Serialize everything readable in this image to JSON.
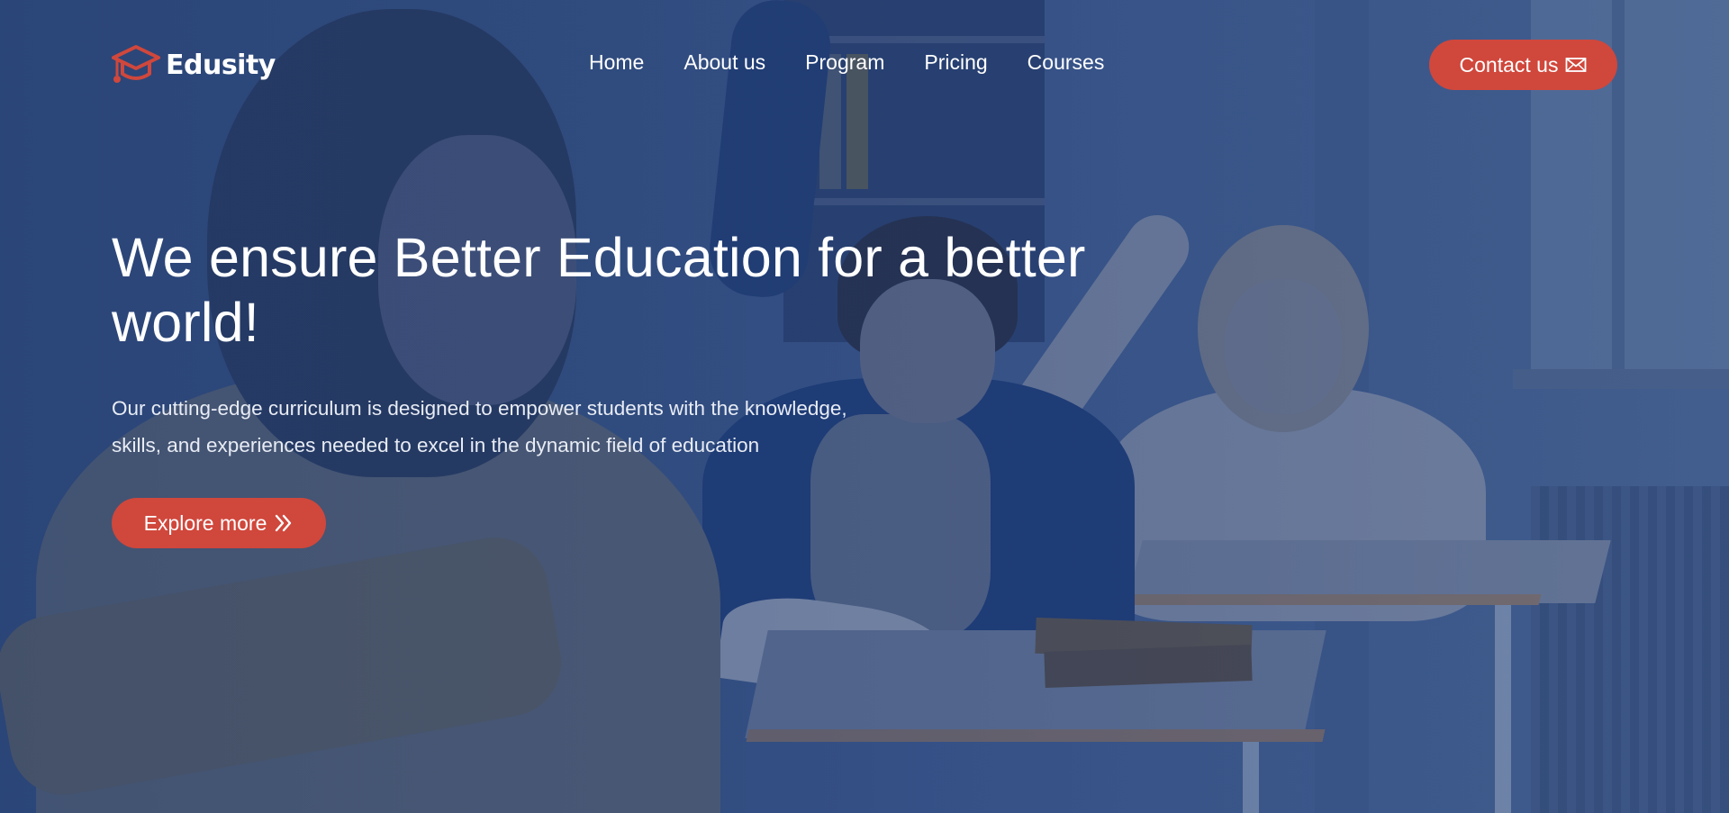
{
  "brand": {
    "name": "Edusity",
    "logo_icon": "graduation-cap-icon",
    "accent": "#d0473c"
  },
  "nav": {
    "items": [
      {
        "label": "Home"
      },
      {
        "label": "About us"
      },
      {
        "label": "Program"
      },
      {
        "label": "Pricing"
      },
      {
        "label": "Courses"
      }
    ],
    "contact_label": "Contact us",
    "contact_icon": "mail-icon"
  },
  "hero": {
    "title": "We ensure Better Education for a better world!",
    "subtitle": "Our cutting-edge curriculum is designed to empower students with the knowledge, skills, and experiences needed to excel in the dynamic field of education",
    "cta_label": "Explore more",
    "cta_icon": "double-chevron-right-icon",
    "background": "classroom-students-photo"
  }
}
